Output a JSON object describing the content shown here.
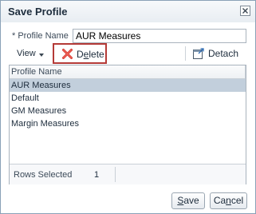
{
  "dialog": {
    "title": "Save Profile",
    "close_icon": "close-icon"
  },
  "form": {
    "required_marker": "*",
    "profile_name_label": "Profile Name",
    "profile_name_value": "AUR Measures"
  },
  "toolbar": {
    "view_label": "View",
    "view_icon": "chevron-down-icon",
    "delete_label_prefix": "D",
    "delete_label_accel": "e",
    "delete_label_suffix": "lete",
    "delete_icon": "red-x-delete-icon",
    "detach_label": "Detach",
    "detach_icon": "detach-icon"
  },
  "table": {
    "column_header": "Profile Name",
    "rows": [
      {
        "name": "AUR Measures",
        "selected": true
      },
      {
        "name": "Default",
        "selected": false
      },
      {
        "name": "GM Measures",
        "selected": false
      },
      {
        "name": "Margin Measures",
        "selected": false
      }
    ],
    "status_label": "Rows Selected",
    "status_value": "1"
  },
  "buttons": {
    "save_accel": "S",
    "save_rest": "ave",
    "cancel_prefix": "Ca",
    "cancel_accel": "n",
    "cancel_suffix": "cel"
  },
  "colors": {
    "selected_row": "#c2cfdc",
    "delete_highlight_border": "#b43a37",
    "delete_icon": "#d7372f"
  }
}
